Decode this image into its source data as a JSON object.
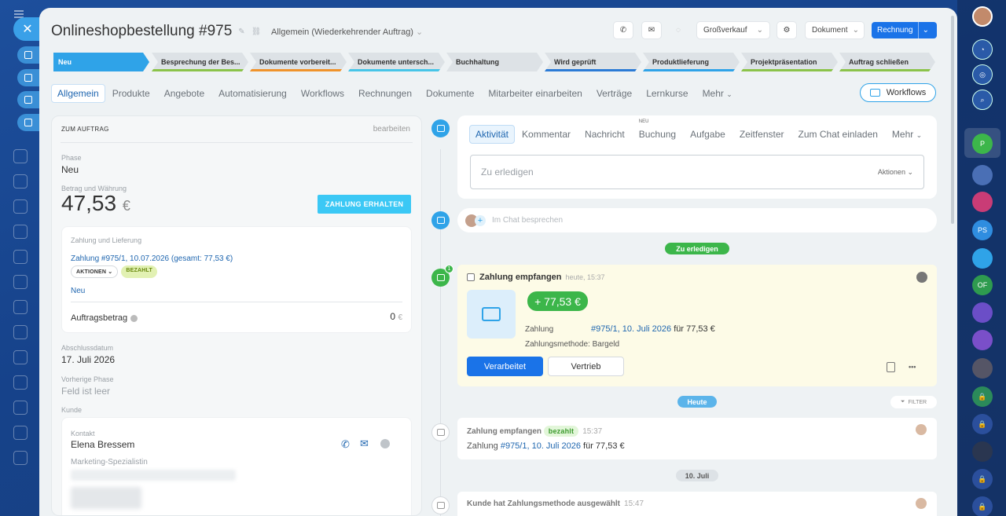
{
  "window": {
    "background_hint": "NEU"
  },
  "header": {
    "title": "Onlineshopbestellung #975",
    "category": "Allgemein (Wiederkehrender Auftrag)",
    "funnel": "Großverkauf",
    "document": "Dokument",
    "invoice": "Rechnung"
  },
  "stages": [
    {
      "label": "Neu",
      "bar": "#2fa3e8"
    },
    {
      "label": "Besprechung der Bes...",
      "bar": "#8bc34a"
    },
    {
      "label": "Dokumente vorbereit...",
      "bar": "#f0932b"
    },
    {
      "label": "Dokumente untersch...",
      "bar": "#47c5e8"
    },
    {
      "label": "Buchhaltung",
      "bar": "#dde2e6"
    },
    {
      "label": "Wird geprüft",
      "bar": "#2b7bd6"
    },
    {
      "label": "Produktlieferung",
      "bar": "#2fa3e8"
    },
    {
      "label": "Projektpräsentation",
      "bar": "#8bc34a"
    },
    {
      "label": "Auftrag schließen",
      "bar": "#8bc34a"
    }
  ],
  "tabs": [
    "Allgemein",
    "Produkte",
    "Angebote",
    "Automatisierung",
    "Workflows",
    "Rechnungen",
    "Dokumente",
    "Mitarbeiter einarbeiten",
    "Verträge",
    "Lernkurse",
    "Mehr"
  ],
  "workflows_btn": "Workflows",
  "left": {
    "header": "ZUM AUFTRAG",
    "edit": "bearbeiten",
    "phase_label": "Phase",
    "phase": "Neu",
    "amount_label": "Betrag und Währung",
    "amount": "47,53",
    "currency": "€",
    "pay_btn": "ZAHLUNG ERHALTEN",
    "payment_box": {
      "title": "Zahlung und Lieferung",
      "link": "Zahlung #975/1, 10.07.2026 (gesamt: 77,53 €)",
      "actions": "AKTIONEN",
      "paid": "BEZAHLT",
      "status": "Neu",
      "order_amount_label": "Auftragsbetrag",
      "order_amount": "0",
      "order_currency": "€"
    },
    "close_date_label": "Abschlussdatum",
    "close_date": "17. Juli 2026",
    "prev_phase_label": "Vorherige Phase",
    "prev_phase": "Feld ist leer",
    "client_label": "Kunde",
    "contact": {
      "label": "Kontakt",
      "name": "Elena Bressem",
      "position": "Marketing-Spezialistin"
    }
  },
  "right": {
    "tabs": [
      "Aktivität",
      "Kommentar",
      "Nachricht",
      "Buchung",
      "Aufgabe",
      "Zeitfenster",
      "Zum Chat einladen",
      "Mehr"
    ],
    "neu_tag": "NEU",
    "todo_placeholder": "Zu erledigen",
    "todo_actions": "Aktionen",
    "chat_placeholder": "Im Chat besprechen",
    "sep_todo": "Zu erledigen",
    "badge_count": "1",
    "pay_card": {
      "title": "Zahlung empfangen",
      "time": "heute, 15:37",
      "amount": "+ 77,53 €",
      "payment_label": "Zahlung",
      "payment_link": "#975/1, 10. Juli 2026",
      "payment_for": "für 77,53 €",
      "method": "Zahlungsmethode: Bargeld",
      "btn_processed": "Verarbeitet",
      "btn_sales": "Vertrieb",
      "more": "•••"
    },
    "sep_today": "Heute",
    "filter": "FILTER",
    "hist1": {
      "title": "Zahlung empfangen",
      "badge": "bezahlt",
      "time": "15:37",
      "text_prefix": "Zahlung",
      "link": "#975/1, 10. Juli 2026",
      "text_suffix": "für 77,53 €"
    },
    "sep_date": "10. Juli",
    "hist2": {
      "title": "Kunde hat Zahlungsmethode ausgewählt",
      "time": "15:47"
    }
  },
  "right_sidebar": {
    "items": [
      "P",
      "PS",
      "OF"
    ]
  },
  "colors": {
    "accent": "#2fa3e8",
    "primary": "#1a73e8",
    "success": "#3cb64a"
  }
}
